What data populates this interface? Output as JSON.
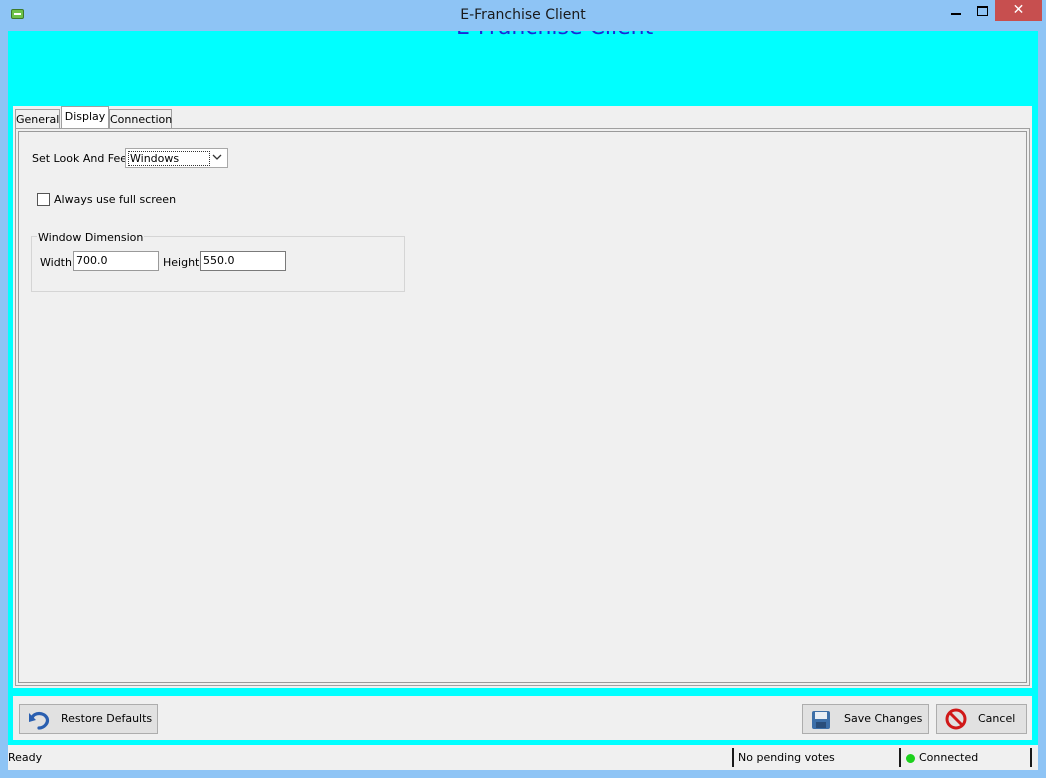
{
  "window": {
    "title": "E-Franchise Client"
  },
  "banner": {
    "text": "E-Franchise Client"
  },
  "tabs": [
    {
      "label": "General"
    },
    {
      "label": "Display"
    },
    {
      "label": "Connection"
    }
  ],
  "display": {
    "look_and_feel_label": "Set Look And Feel",
    "look_and_feel_value": "Windows",
    "fullscreen_label": "Always use full screen",
    "fullscreen_checked": false,
    "dimension_group_label": "Window Dimension",
    "width_label": "Width",
    "width_value": "700.0",
    "height_label": "Height",
    "height_value": "550.0"
  },
  "buttons": {
    "restore": "Restore Defaults",
    "save": "Save Changes",
    "cancel": "Cancel"
  },
  "status": {
    "ready": "Ready",
    "votes": "No pending votes",
    "connection": "Connected"
  },
  "colors": {
    "banner_bg": "#00ffff",
    "titlebar": "#8ec4f5",
    "connected": "#1cd11c"
  },
  "icons": {
    "app": "app-icon",
    "restore": "undo-arrow-icon",
    "save": "floppy-disk-icon",
    "cancel": "no-entry-icon"
  }
}
